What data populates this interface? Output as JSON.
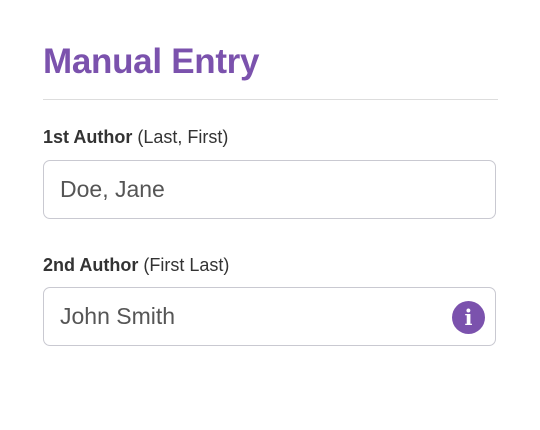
{
  "form": {
    "title": "Manual Entry",
    "fields": [
      {
        "label_strong": "1st Author",
        "label_hint": "(Last, First)",
        "value": "Doe, Jane"
      },
      {
        "label_strong": "2nd Author",
        "label_hint": "(First Last)",
        "value": "John Smith",
        "info_icon": "info-icon",
        "info_glyph": "i"
      }
    ]
  },
  "colors": {
    "accent": "#7b52ad",
    "border": "#c9c9d1",
    "divider": "#dddddd"
  }
}
